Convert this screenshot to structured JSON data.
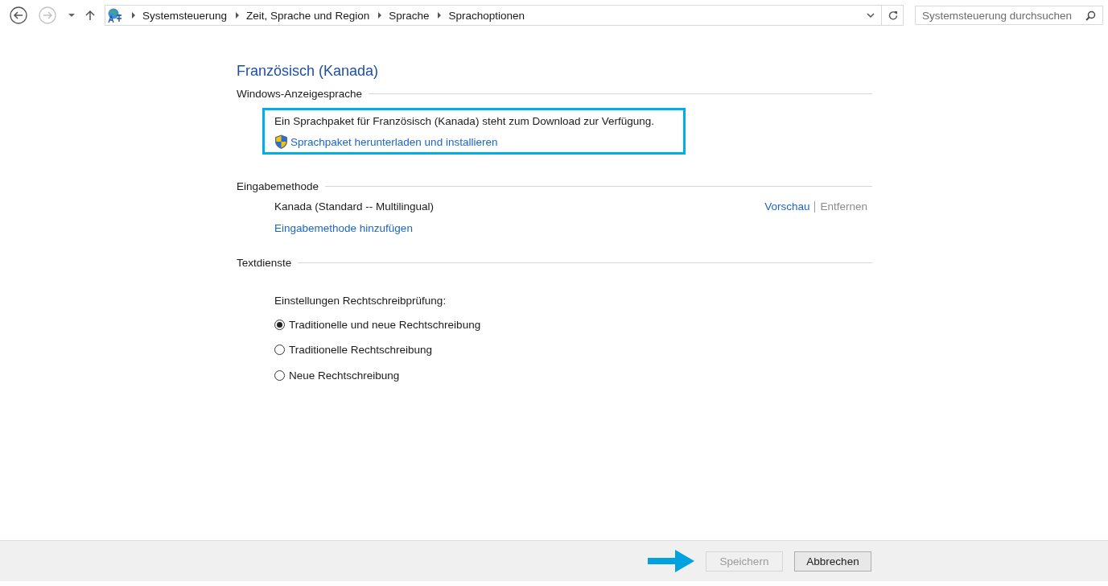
{
  "navigation": {
    "back_disabled": false,
    "forward_disabled": true
  },
  "breadcrumb": [
    "Systemsteuerung",
    "Zeit, Sprache und Region",
    "Sprache",
    "Sprachoptionen"
  ],
  "search": {
    "placeholder": "Systemsteuerung durchsuchen"
  },
  "title": "Französisch (Kanada)",
  "display_language": {
    "heading": "Windows-Anzeigesprache",
    "message": "Ein Sprachpaket für Französisch (Kanada) steht zum Download zur Verfügung.",
    "link": "Sprachpaket herunterladen und installieren"
  },
  "input_method": {
    "heading": "Eingabemethode",
    "methods": [
      {
        "name": "Kanada (Standard -- Multilingual)",
        "actions": [
          {
            "label": "Vorschau",
            "disabled": false
          },
          {
            "label": "Entfernen",
            "disabled": true
          }
        ]
      }
    ],
    "add_link": "Eingabemethode hinzufügen"
  },
  "text_services": {
    "heading": "Textdienste",
    "label": "Einstellungen Rechtschreibprüfung:",
    "options": [
      {
        "label": "Traditionelle und neue Rechtschreibung",
        "selected": true
      },
      {
        "label": "Traditionelle Rechtschreibung",
        "selected": false
      },
      {
        "label": "Neue Rechtschreibung",
        "selected": false
      }
    ]
  },
  "buttons": [
    {
      "label": "Speichern",
      "disabled": true
    },
    {
      "label": "Abbrechen",
      "disabled": false
    }
  ]
}
